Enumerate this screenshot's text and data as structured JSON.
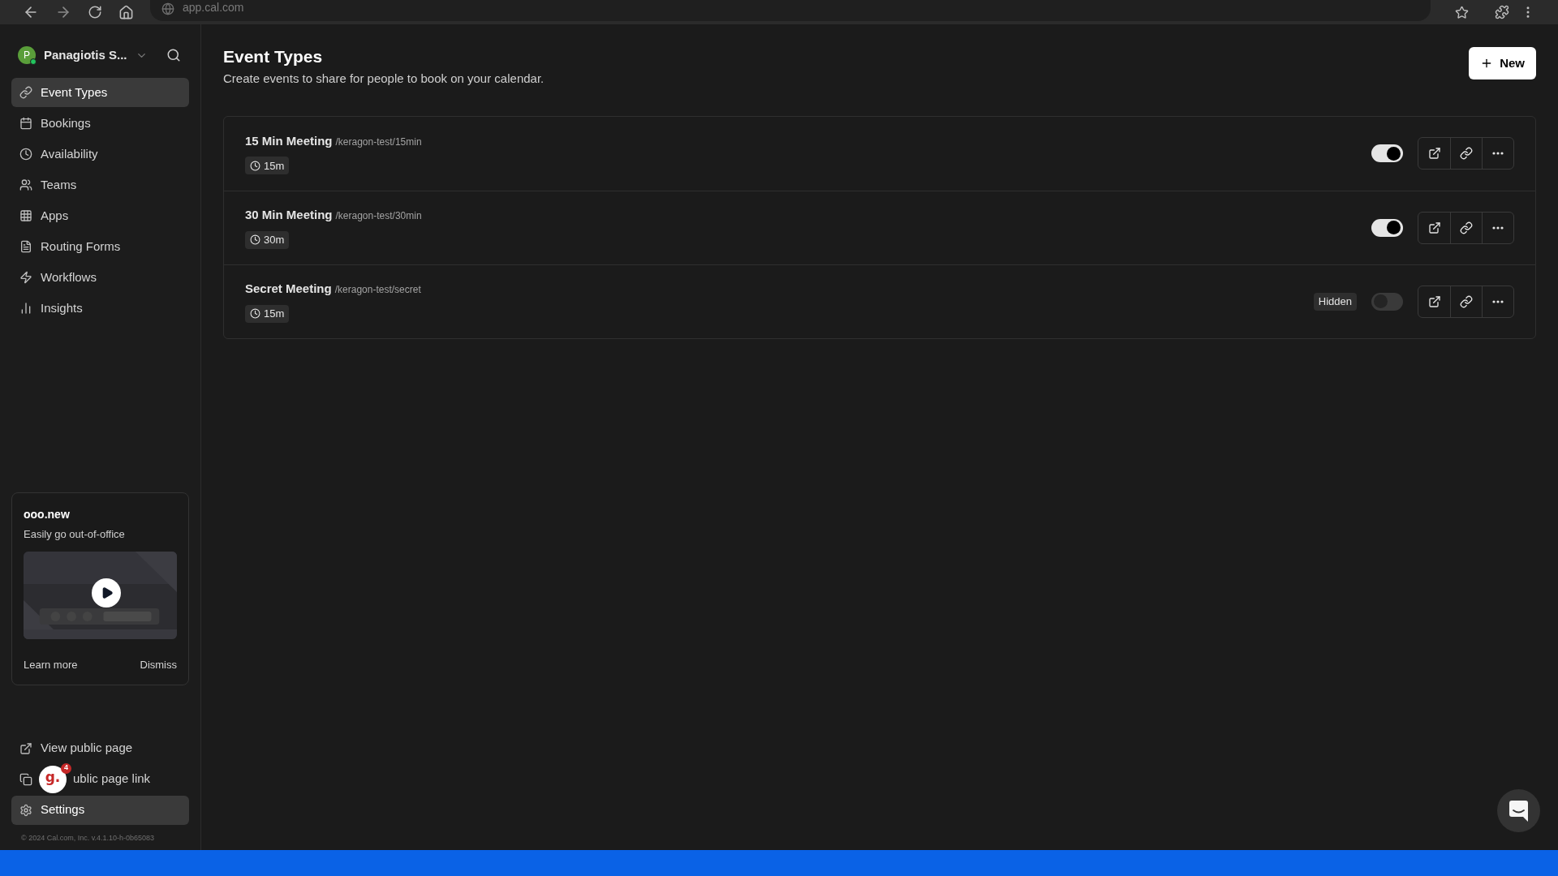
{
  "browser": {
    "url": "app.cal.com"
  },
  "sidebar": {
    "user": {
      "initial": "P",
      "name": "Panagiotis S...",
      "online": true
    },
    "nav": [
      {
        "label": "Event Types",
        "selected": true
      },
      {
        "label": "Bookings",
        "selected": false
      },
      {
        "label": "Availability",
        "selected": false
      },
      {
        "label": "Teams",
        "selected": false
      },
      {
        "label": "Apps",
        "selected": false
      },
      {
        "label": "Routing Forms",
        "selected": false
      },
      {
        "label": "Workflows",
        "selected": false
      },
      {
        "label": "Insights",
        "selected": false
      }
    ],
    "promo": {
      "title": "ooo.new",
      "subtitle": "Easily go out-of-office",
      "learn_more": "Learn more",
      "dismiss": "Dismiss"
    },
    "bottom": [
      {
        "kind": "external",
        "label": "View public page",
        "selected": false
      },
      {
        "kind": "copy",
        "label": "ublic page link",
        "selected": false
      },
      {
        "kind": "settings",
        "label": "Settings",
        "selected": true
      }
    ],
    "footer": "© 2024 Cal.com, Inc. v.4.1.10-h-0b65083"
  },
  "header": {
    "title": "Event Types",
    "subtitle": "Create events to share for people to book on your calendar.",
    "new_button": "New"
  },
  "event_types": [
    {
      "title": "15 Min Meeting",
      "slug": "/keragon-test/15min",
      "duration": "15m",
      "enabled": true
    },
    {
      "title": "30 Min Meeting",
      "slug": "/keragon-test/30min",
      "duration": "30m",
      "enabled": true
    },
    {
      "title": "Secret Meeting",
      "slug": "/keragon-test/secret",
      "duration": "15m",
      "badge": "Hidden",
      "enabled": false
    }
  ],
  "widget": {
    "logo": "g.",
    "count": "4"
  }
}
